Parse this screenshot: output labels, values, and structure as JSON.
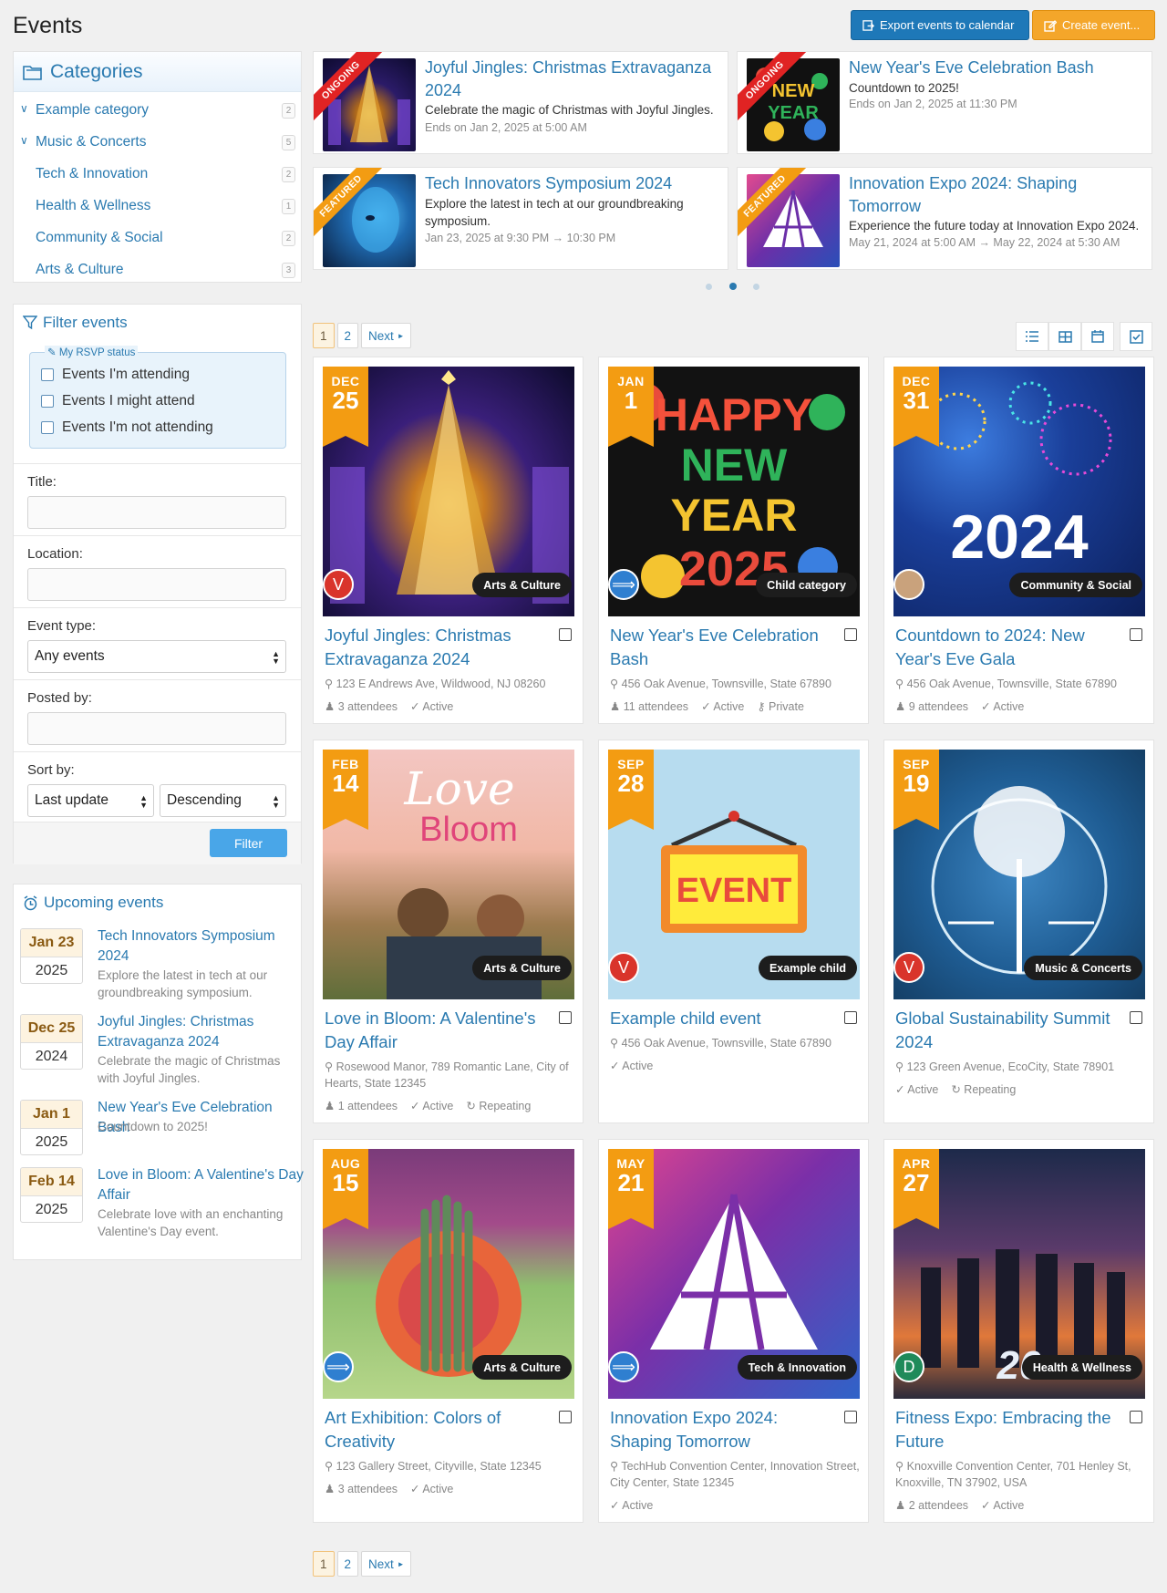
{
  "header": {
    "title": "Events",
    "export_label": "Export events to calendar",
    "create_label": "Create event..."
  },
  "categories": {
    "title": "Categories",
    "items": [
      {
        "label": "Example category",
        "count": "2",
        "expanded": true
      },
      {
        "label": "Music & Concerts",
        "count": "5",
        "expanded": true
      },
      {
        "label": "Tech & Innovation",
        "count": "2"
      },
      {
        "label": "Health & Wellness",
        "count": "1"
      },
      {
        "label": "Community & Social",
        "count": "2"
      },
      {
        "label": "Arts & Culture",
        "count": "3"
      }
    ]
  },
  "filter": {
    "title": "Filter events",
    "rsvp_legend": "My RSVP status",
    "rsvp_options": [
      "Events I'm attending",
      "Events I might attend",
      "Events I'm not attending"
    ],
    "title_label": "Title:",
    "location_label": "Location:",
    "type_label": "Event type:",
    "type_value": "Any events",
    "posted_label": "Posted by:",
    "sort_label": "Sort by:",
    "sort_value": "Last update",
    "order_value": "Descending",
    "button": "Filter"
  },
  "upcoming": {
    "title": "Upcoming events",
    "items": [
      {
        "md": "Jan 23",
        "yr": "2025",
        "title": "Tech Innovators Symposium 2024",
        "desc": "Explore the latest in tech at our groundbreaking symposium."
      },
      {
        "md": "Dec 25",
        "yr": "2024",
        "title": "Joyful Jingles: Christmas Extravaganza 2024",
        "desc": "Celebrate the magic of Christmas with Joyful Jingles."
      },
      {
        "md": "Jan 1",
        "yr": "2025",
        "title": "New Year's Eve Celebration Bash",
        "desc": "Countdown to 2025!"
      },
      {
        "md": "Feb 14",
        "yr": "2025",
        "title": "Love in Bloom: A Valentine's Day Affair",
        "desc": "Celebrate love with an enchanting Valentine's Day event."
      }
    ]
  },
  "featured": [
    {
      "ribbon": "ONGOING",
      "title": "Joyful Jingles: Christmas Extravaganza 2024",
      "desc": "Celebrate the magic of Christmas with Joyful Jingles.",
      "meta": "Ends on Jan 2, 2025 at 5:00 AM"
    },
    {
      "ribbon": "ONGOING",
      "title": "New Year's Eve Celebration Bash",
      "desc": "Countdown to 2025!",
      "meta": "Ends on Jan 2, 2025 at 11:30 PM"
    },
    {
      "ribbon": "FEATURED",
      "title": "Tech Innovators Symposium 2024",
      "desc": "Explore the latest in tech at our groundbreaking symposium.",
      "meta": "Jan 23, 2025 at 9:30 PM → 10:30 PM"
    },
    {
      "ribbon": "FEATURED",
      "title": "Innovation Expo 2024: Shaping Tomorrow",
      "desc": "Experience the future today at Innovation Expo 2024.",
      "meta": "May 21, 2024 at 5:00 AM → May 22, 2024 at 5:30 AM"
    }
  ],
  "pagination": {
    "pages": [
      "1",
      "2"
    ],
    "next": "Next"
  },
  "cards": [
    {
      "month": "DEC",
      "day": "25",
      "category": "Arts & Culture",
      "avatar": "V",
      "title": "Joyful Jingles: Christmas Extravaganza 2024",
      "location": "123 E Andrews Ave, Wildwood, NJ 08260",
      "attendees": "3 attendees",
      "status": "Active",
      "extra": ""
    },
    {
      "month": "JAN",
      "day": "1",
      "category": "Child category",
      "avatar": "",
      "title": "New Year's Eve Celebration Bash",
      "location": "456 Oak Avenue, Townsville, State 67890",
      "attendees": "11 attendees",
      "status": "Active",
      "extra": "Private"
    },
    {
      "month": "DEC",
      "day": "31",
      "category": "Community & Social",
      "avatar": "",
      "title": "Countdown to 2024: New Year's Eve Gala",
      "location": "456 Oak Avenue, Townsville, State 67890",
      "attendees": "9 attendees",
      "status": "Active",
      "extra": "",
      "image_text": "2024"
    },
    {
      "month": "FEB",
      "day": "14",
      "category": "Arts & Culture",
      "avatar": "",
      "title": "Love in Bloom: A Valentine's Day Affair",
      "location": "Rosewood Manor, 789 Romantic Lane, City of Hearts, State 12345",
      "attendees": "1 attendees",
      "status": "Active",
      "extra": "Repeating"
    },
    {
      "month": "SEP",
      "day": "28",
      "category": "Example child",
      "avatar": "V",
      "title": "Example child event",
      "location": "456 Oak Avenue, Townsville, State 67890",
      "attendees": "",
      "status": "Active",
      "extra": "",
      "image_text": "EVENT"
    },
    {
      "month": "SEP",
      "day": "19",
      "category": "Music & Concerts",
      "avatar": "V",
      "title": "Global Sustainability Summit 2024",
      "location": "123 Green Avenue, EcoCity, State 78901",
      "attendees": "",
      "status": "Active",
      "extra": "Repeating"
    },
    {
      "month": "AUG",
      "day": "15",
      "category": "Arts & Culture",
      "avatar": "",
      "title": "Art Exhibition: Colors of Creativity",
      "location": "123 Gallery Street, Cityville, State 12345",
      "attendees": "3 attendees",
      "status": "Active",
      "extra": ""
    },
    {
      "month": "MAY",
      "day": "21",
      "category": "Tech & Innovation",
      "avatar": "",
      "title": "Innovation Expo 2024: Shaping Tomorrow",
      "location": "TechHub Convention Center, Innovation Street, City Center, State 12345",
      "attendees": "",
      "status": "Active",
      "extra": ""
    },
    {
      "month": "APR",
      "day": "27",
      "category": "Health & Wellness",
      "avatar": "D",
      "title": "Fitness Expo: Embracing the Future",
      "location": "Knoxville Convention Center, 701 Henley St, Knoxville, TN 37902, USA",
      "attendees": "2 attendees",
      "status": "Active",
      "extra": ""
    }
  ]
}
